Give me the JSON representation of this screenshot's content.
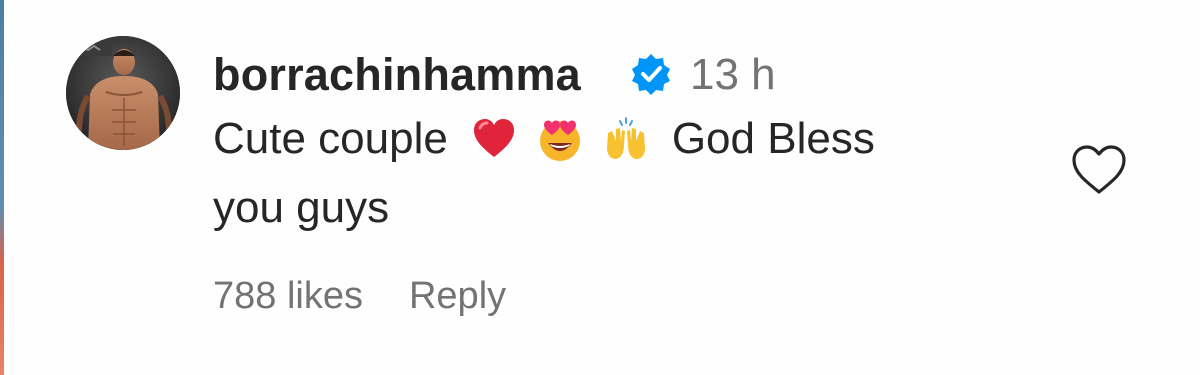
{
  "comment": {
    "username": "borrachinhamma",
    "verified": true,
    "timestamp": "13 h",
    "text_part1": "Cute couple",
    "text_part2": "God Bless",
    "text_part3": "you guys",
    "emojis": [
      "red-heart-emoji",
      "smiling-face-with-heart-eyes-emoji",
      "raising-hands-emoji"
    ],
    "likes": "788 likes",
    "reply_label": "Reply"
  },
  "colors": {
    "primary_text": "#262626",
    "secondary_text": "#737373",
    "verified_badge": "#0095f6"
  },
  "icons": {
    "like": "heart-outline-icon",
    "badge": "verified-badge-icon"
  }
}
